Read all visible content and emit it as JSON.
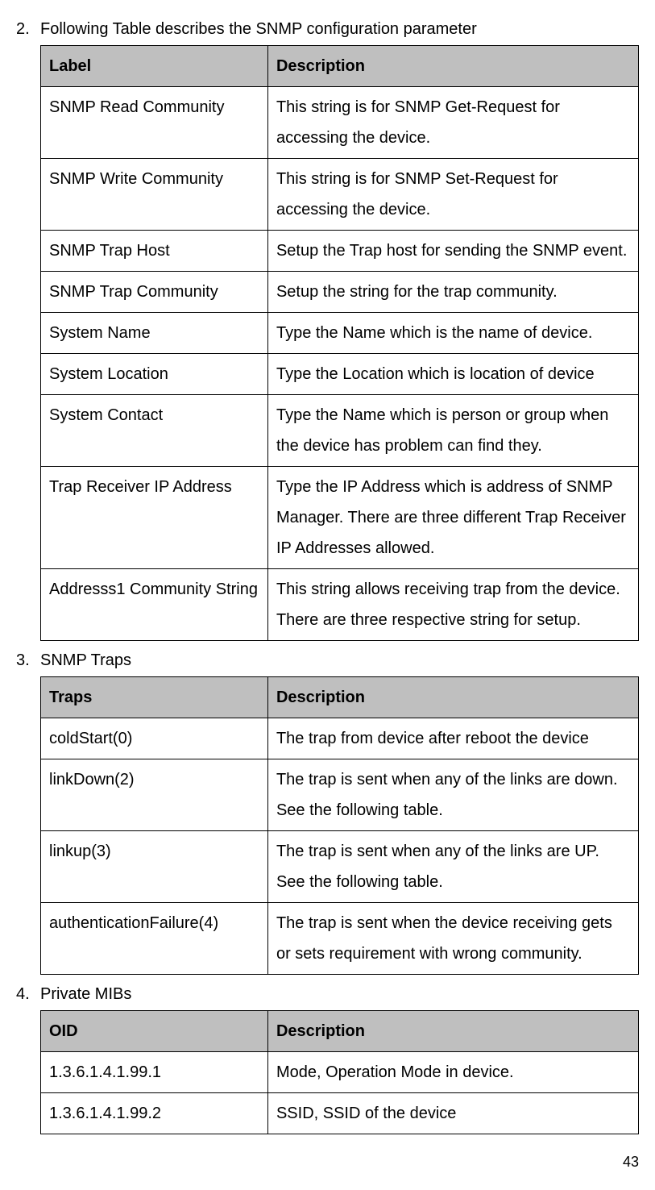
{
  "section2": {
    "number": "2.",
    "title": "Following Table describes the SNMP configuration parameter",
    "header": {
      "label": "Label",
      "description": "Description"
    },
    "rows": [
      {
        "label": "SNMP Read Community",
        "description": "This string is for SNMP Get-Request for accessing the device."
      },
      {
        "label": "SNMP Write Community",
        "description": "This string is for SNMP Set-Request for accessing the device."
      },
      {
        "label": "SNMP Trap Host",
        "description": "Setup the Trap host for sending the SNMP event."
      },
      {
        "label": "SNMP Trap Community",
        "description": "Setup the string for the trap community."
      },
      {
        "label": "System Name",
        "description": "Type the Name which is the name of device."
      },
      {
        "label": "System Location",
        "description": "Type the Location which is location of device"
      },
      {
        "label": "System Contact",
        "description": "Type the Name which is person or group when the device has problem can find they."
      },
      {
        "label": "Trap Receiver IP Address",
        "description": "Type the IP Address which is address of SNMP Manager. There are three different Trap Receiver IP Addresses allowed."
      },
      {
        "label": "Addresss1 Community String",
        "description": "This string allows receiving trap from the device. There are three respective string for setup."
      }
    ]
  },
  "section3": {
    "number": "3.",
    "title": "SNMP Traps",
    "header": {
      "label": "Traps",
      "description": "Description"
    },
    "rows": [
      {
        "label": "coldStart(0)",
        "description": "The trap from device after reboot the device"
      },
      {
        "label": "linkDown(2)",
        "description": "The trap is sent when any of the links are down. See the following table."
      },
      {
        "label": "linkup(3)",
        "description": "The trap is sent when any of the links are UP. See the following table."
      },
      {
        "label": "authenticationFailure(4)",
        "description": "The trap is sent when the device receiving gets or sets requirement with wrong community."
      }
    ]
  },
  "section4": {
    "number": "4.",
    "title": "Private MIBs",
    "header": {
      "label": "OID",
      "description": "Description"
    },
    "rows": [
      {
        "label": "1.3.6.1.4.1.99.1",
        "description": "Mode, Operation Mode in device."
      },
      {
        "label": "1.3.6.1.4.1.99.2",
        "description": "SSID, SSID of the device"
      }
    ]
  },
  "pageNumber": "43"
}
